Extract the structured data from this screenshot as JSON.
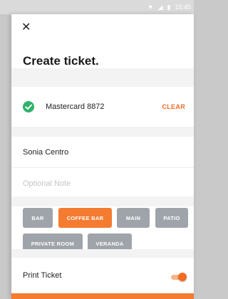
{
  "status_bar": {
    "time": "15:45",
    "icons": [
      "wifi-icon",
      "signal-icon",
      "battery-icon"
    ]
  },
  "header": {
    "close_icon": "close-icon",
    "title": "Create ticket."
  },
  "payment": {
    "status_icon": "check-circle-icon",
    "card_label": "Mastercard 8872",
    "clear_label": "CLEAR"
  },
  "customer": {
    "name": "Sonia Centro",
    "note_value": "",
    "note_placeholder": "Optional Note"
  },
  "locations": {
    "items": [
      {
        "label": "BAR",
        "selected": false
      },
      {
        "label": "COFFEE BAR",
        "selected": true
      },
      {
        "label": "MAIN",
        "selected": false
      },
      {
        "label": "PATIO",
        "selected": false
      },
      {
        "label": "PRIVATE ROOM",
        "selected": false
      },
      {
        "label": "VERANDA",
        "selected": false
      }
    ]
  },
  "print": {
    "label": "Print Ticket",
    "enabled": true
  },
  "colors": {
    "accent": "#f47b30",
    "success": "#2fb36b",
    "tag_inactive": "#9fa4aa"
  }
}
